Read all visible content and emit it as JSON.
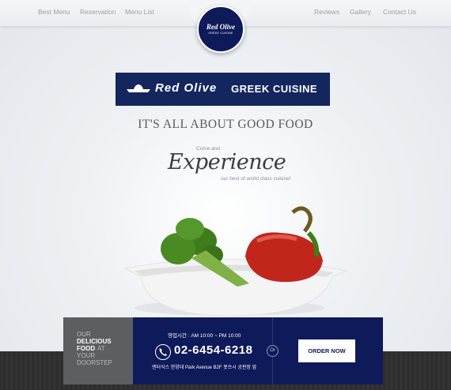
{
  "nav": {
    "left": [
      "Best Menu",
      "Reservation",
      "Menu List"
    ],
    "right": [
      "Reviews",
      "Gallery",
      "Contact Us"
    ]
  },
  "logo": {
    "line1": "Red Olive",
    "line2": "GREEK CUISINE"
  },
  "banner": {
    "brand": "Red Olive",
    "subtitle": "GREEK CUISINE"
  },
  "tagline": "IT'S ALL ABOUT GOOD FOOD",
  "experience": {
    "come": "Come and",
    "word": "Experience",
    "sub": "our best of world class cuisine!"
  },
  "promo": {
    "line1": "OUR",
    "line2": "DELICIOUS",
    "line3": "FOOD",
    "line3b": "AT",
    "line4": "YOUR",
    "line5": "DOORSTEP"
  },
  "delivery": {
    "hours": "영업시간 : AM 10:00 ~ PM 10:00",
    "phone": "02-6454-6218",
    "address": "엔터식스 한양대 Park Avenue B2F 못쓰시 공판장 앞",
    "or": "Or",
    "order_label": "ORDER NOW"
  },
  "colors": {
    "navy": "#0f1a5a",
    "banner": "#13265e",
    "grey": "#5c5e61",
    "accent": "#ffffff"
  }
}
